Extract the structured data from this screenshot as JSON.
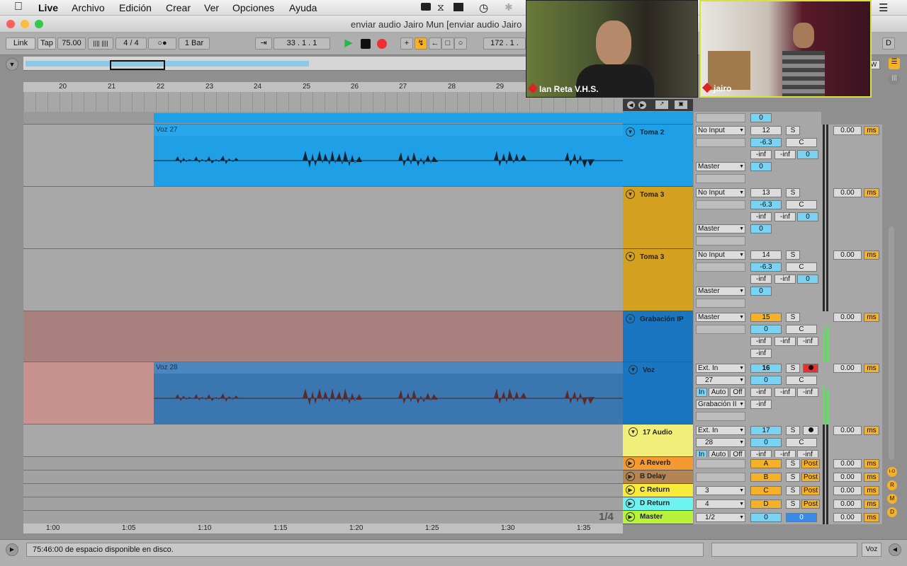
{
  "menubar": {
    "app": "Live",
    "items": [
      "Archivo",
      "Edición",
      "Crear",
      "Ver",
      "Opciones",
      "Ayuda"
    ]
  },
  "window": {
    "title": "enviar audio Jairo Mun  [enviar audio Jairo"
  },
  "control_bar": {
    "link": "Link",
    "tap": "Tap",
    "tempo": "75.00",
    "signature": "4 / 4",
    "metro": "○●",
    "quantize": "1 Bar",
    "position": "33 .  1 .  1",
    "loop_length": "172 .  1 .",
    "d_label": "D",
    "w_label": "W"
  },
  "ruler": {
    "bars": [
      "20",
      "21",
      "22",
      "23",
      "24",
      "25",
      "26",
      "27",
      "28",
      "29"
    ]
  },
  "time_ruler": {
    "labels": [
      "1:00",
      "1:05",
      "1:10",
      "1:15",
      "1:20",
      "1:25",
      "1:30",
      "1:35"
    ]
  },
  "page_indicator": "1/4",
  "tracks": [
    {
      "name": "Toma 2",
      "color": "#1e9fe6",
      "input": "No Input",
      "output": "Master",
      "num": "12",
      "vol": "-6.3",
      "pan": "C",
      "send_a": "-inf",
      "send_b": "-inf",
      "send_c": "0",
      "send_d": "0",
      "delay": "0.00",
      "ms": "ms",
      "clip": "Voz 27"
    },
    {
      "name": "Toma 3",
      "color": "#d4a020",
      "input": "No Input",
      "output": "Master",
      "num": "13",
      "vol": "-6.3",
      "pan": "C",
      "send_a": "-inf",
      "send_b": "-inf",
      "send_c": "0",
      "send_d": "0",
      "delay": "0.00",
      "ms": "ms"
    },
    {
      "name": "Toma 3",
      "color": "#d4a020",
      "input": "No Input",
      "output": "Master",
      "num": "14",
      "vol": "-6.3",
      "pan": "C",
      "send_a": "-inf",
      "send_b": "-inf",
      "send_c": "0",
      "send_d": "0",
      "delay": "0.00",
      "ms": "ms"
    },
    {
      "name": "Grabación IP",
      "color": "#1b76c2",
      "input": "Master",
      "num": "15",
      "vol": "0",
      "pan": "C",
      "send_a": "-inf",
      "send_b": "-inf",
      "send_c": "-inf",
      "send_d": "-inf",
      "delay": "0.00",
      "ms": "ms"
    },
    {
      "name": "Voz",
      "color": "#1b76c2",
      "input": "Ext. In",
      "input_ch": "27",
      "monitor": [
        "In",
        "Auto",
        "Off"
      ],
      "output": "Grabación II",
      "num": "16",
      "vol": "0",
      "pan": "C",
      "send_a": "-inf",
      "send_b": "-inf",
      "send_c": "-inf",
      "send_d": "-inf",
      "delay": "0.00",
      "ms": "ms",
      "clip": "Voz 28"
    },
    {
      "name": "17 Audio",
      "color": "#f2ee7a",
      "input": "Ext. In",
      "input_ch": "28",
      "monitor": [
        "In",
        "Auto",
        "Off"
      ],
      "num": "17",
      "vol": "0",
      "pan": "C",
      "send_a": "-inf",
      "send_b": "-inf",
      "send_c": "-inf",
      "delay": "0.00",
      "ms": "ms"
    }
  ],
  "top_partial": {
    "value": "0"
  },
  "returns": [
    {
      "name": "A Reverb",
      "color": "#f49a30",
      "letter": "A",
      "solo": "S",
      "post": "Post",
      "delay": "0.00",
      "ms": "ms"
    },
    {
      "name": "B Delay",
      "color": "#b38552",
      "letter": "B",
      "solo": "S",
      "post": "Post",
      "delay": "0.00",
      "ms": "ms"
    },
    {
      "name": "C Return",
      "color": "#f7ea3a",
      "letter": "C",
      "input": "3",
      "solo": "S",
      "post": "Post",
      "delay": "0.00",
      "ms": "ms"
    },
    {
      "name": "D Return",
      "color": "#6ef3f0",
      "letter": "D",
      "input": "4",
      "solo": "S",
      "post": "Post",
      "delay": "0.00",
      "ms": "ms"
    }
  ],
  "master": {
    "name": "Master",
    "color": "#b8f23a",
    "input": "1/2",
    "vol": "0",
    "pan": "0",
    "delay": "0.00",
    "ms": "ms"
  },
  "solo_label": "S",
  "side_buttons": [
    "I·O",
    "R",
    "M",
    "D"
  ],
  "video_call": [
    {
      "name": "Ian Reta V.H.S."
    },
    {
      "name": "jairo"
    }
  ],
  "status": {
    "message": "75:46:00 de espacio disponible en disco.",
    "track_name": "Voz"
  }
}
